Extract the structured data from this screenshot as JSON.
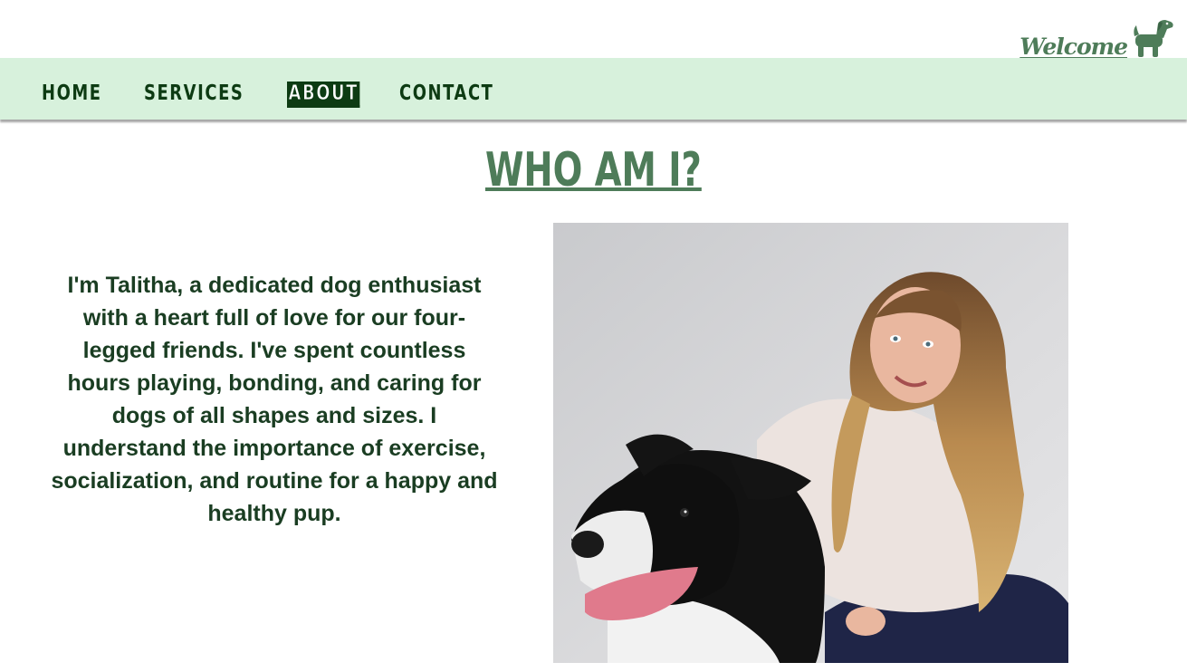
{
  "header": {
    "brand_text": "Welcome",
    "brand_icon": "dog-icon"
  },
  "nav": {
    "items": [
      {
        "label": "HOME",
        "active": false
      },
      {
        "label": "SERVICES",
        "active": false
      },
      {
        "label": "ABOUT",
        "active": true
      },
      {
        "label": "CONTACT",
        "active": false
      }
    ]
  },
  "main": {
    "title": "WHO AM I?",
    "bio": "I'm Talitha, a dedicated dog enthusiast with a heart full of love for our four-legged friends. I've spent countless hours playing, bonding, and caring for dogs of all shapes and sizes. I understand the importance of exercise, socialization, and routine for a happy and healthy pup.",
    "photo_subject": "woman-with-border-collie-photo"
  },
  "colors": {
    "nav_background": "#d7f1dc",
    "nav_text": "#0d3b13",
    "accent_green": "#4e7c59",
    "body_text": "#1a3d22"
  }
}
